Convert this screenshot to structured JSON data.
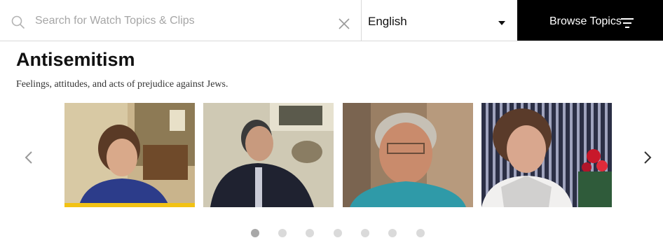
{
  "search": {
    "placeholder": "Search for Watch Topics & Clips",
    "value": ""
  },
  "language": {
    "selected": "English"
  },
  "browse": {
    "label": "Browse Topics"
  },
  "topic": {
    "title": "Antisemitism",
    "description": "Feelings, attitudes, and acts of prejudice against Jews."
  },
  "carousel": {
    "active_index": 1,
    "dot_count": 7,
    "accent_color": "#f2c214"
  },
  "icons": [
    "search-icon",
    "close-icon",
    "chevron-down-icon",
    "filter-icon",
    "chevron-left-icon",
    "chevron-right-icon"
  ]
}
